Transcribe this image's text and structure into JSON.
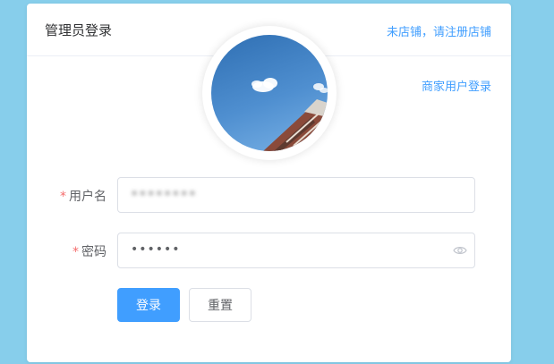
{
  "card": {
    "title": "管理员登录",
    "register_link": "未店铺，请注册店铺",
    "merchant_link": "商家用户登录"
  },
  "form": {
    "username": {
      "required_mark": "*",
      "label": "用户名",
      "value": "••••••••"
    },
    "password": {
      "required_mark": "*",
      "label": "密码",
      "value": "••••••"
    },
    "login_button": "登录",
    "reset_button": "重置"
  },
  "colors": {
    "page_background": "#87ceeb",
    "primary": "#409eff",
    "required": "#f56c6c"
  },
  "icons": {
    "password_toggle": "eye-icon"
  }
}
